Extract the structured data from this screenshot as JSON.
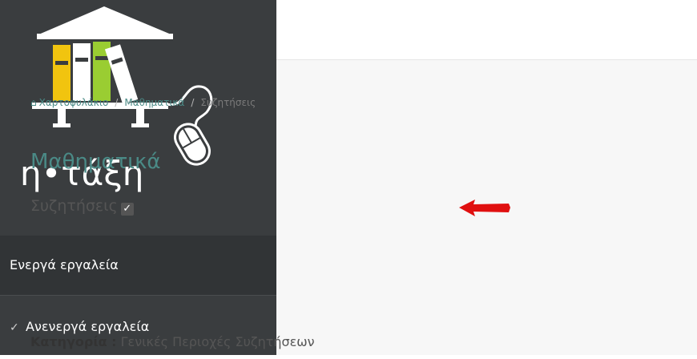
{
  "logo": {
    "text": "η•τάξη",
    "icon": "bookshelf-mouse-logo"
  },
  "sidebar": {
    "items": [
      {
        "label": "Ενεργά εργαλεία",
        "icon": ""
      },
      {
        "label": "Ανενεργά εργαλεία",
        "icon": "checkmark-icon"
      }
    ]
  },
  "breadcrumb": {
    "home_label": "Χαρτοφυλάκιο",
    "course_label": "Μαθηματικά",
    "current_label": "Συζητήσεις",
    "separator": "/"
  },
  "page": {
    "title": "Μαθηματικά",
    "subtitle": "Συζητήσεις"
  },
  "category": {
    "label": "Κατηγορία :",
    "value": "Γενικές Περιοχές Συζητήσεων"
  },
  "colors": {
    "sidebar_bg": "#3a3d3f",
    "accent": "#4a8a86",
    "arrow": "#e01010"
  }
}
